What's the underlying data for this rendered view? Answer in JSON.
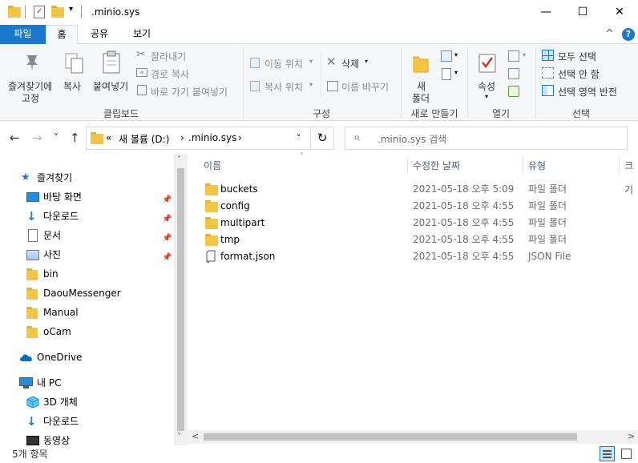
{
  "window": {
    "title": ".minio.sys",
    "minimize_glyph": "—",
    "maximize_glyph": "☐",
    "close_glyph": "✕"
  },
  "ribbon_tabs": [
    {
      "label": "파일"
    },
    {
      "label": "홈"
    },
    {
      "label": "공유"
    },
    {
      "label": "보기"
    }
  ],
  "ribbon": {
    "clipboard": {
      "pin_label_1": "즐겨찾기에",
      "pin_label_2": "고정",
      "copy": "복사",
      "paste": "붙여넣기",
      "cut": "잘라내기",
      "copy_path": "경로 복사",
      "paste_shortcut": "바로 가기 붙여넣기",
      "group": "클립보드"
    },
    "organize": {
      "move_to": "이동 위치",
      "copy_to": "복사 위치",
      "delete": "삭제",
      "rename": "이름 바꾸기",
      "group": "구성"
    },
    "new": {
      "new_folder_1": "새",
      "new_folder_2": "폴더",
      "group": "새로 만들기"
    },
    "open": {
      "properties": "속성",
      "group": "열기"
    },
    "select": {
      "select_all": "모두 선택",
      "select_none": "선택 안 함",
      "invert": "선택 영역 반전",
      "group": "선택"
    },
    "help_glyph": "?",
    "collapse_glyph": "^"
  },
  "address": {
    "back": "←",
    "forward": "→",
    "recent": "˅",
    "up": "↑",
    "overflow": "«",
    "crumb_drive": "새 볼륨 (D:)",
    "crumb_sep": "›",
    "crumb_folder": ".minio.sys",
    "refresh": "↻",
    "search_placeholder": ".minio.sys 검색",
    "search_glyph": "⌕"
  },
  "nav": {
    "quick_access": "즐겨찾기",
    "items": [
      {
        "label": "바탕 화면",
        "pinned": true
      },
      {
        "label": "다운로드",
        "pinned": true
      },
      {
        "label": "문서",
        "pinned": true
      },
      {
        "label": "사진",
        "pinned": true
      },
      {
        "label": "bin",
        "pinned": false
      },
      {
        "label": "DaouMessenger",
        "pinned": false
      },
      {
        "label": "Manual",
        "pinned": false
      },
      {
        "label": "oCam",
        "pinned": false
      }
    ],
    "onedrive": "OneDrive",
    "this_pc": "내 PC",
    "pc_items": [
      {
        "label": "3D 개체"
      },
      {
        "label": "다운로드"
      },
      {
        "label": "동영상"
      }
    ],
    "scroll_up": "˄",
    "scroll_down": "˅"
  },
  "columns": {
    "name": "이름",
    "date": "수정한 날짜",
    "type": "유형",
    "size": "크기"
  },
  "files": [
    {
      "name": "buckets",
      "date": "2021-05-18 오후 5:09",
      "type": "파일 폴더",
      "kind": "folder"
    },
    {
      "name": "config",
      "date": "2021-05-18 오후 4:55",
      "type": "파일 폴더",
      "kind": "folder"
    },
    {
      "name": "multipart",
      "date": "2021-05-18 오후 4:55",
      "type": "파일 폴더",
      "kind": "folder"
    },
    {
      "name": "tmp",
      "date": "2021-05-18 오후 4:55",
      "type": "파일 폴더",
      "kind": "folder"
    },
    {
      "name": "format.json",
      "date": "2021-05-18 오후 4:55",
      "type": "JSON File",
      "kind": "file"
    }
  ],
  "hscroll": {
    "left": "<",
    "right": ">"
  },
  "status": {
    "count": "5개 항목"
  },
  "colors": {
    "accent": "#1979ca",
    "folder": "#f4c542",
    "ribbon_bg": "#f5f6f7"
  }
}
